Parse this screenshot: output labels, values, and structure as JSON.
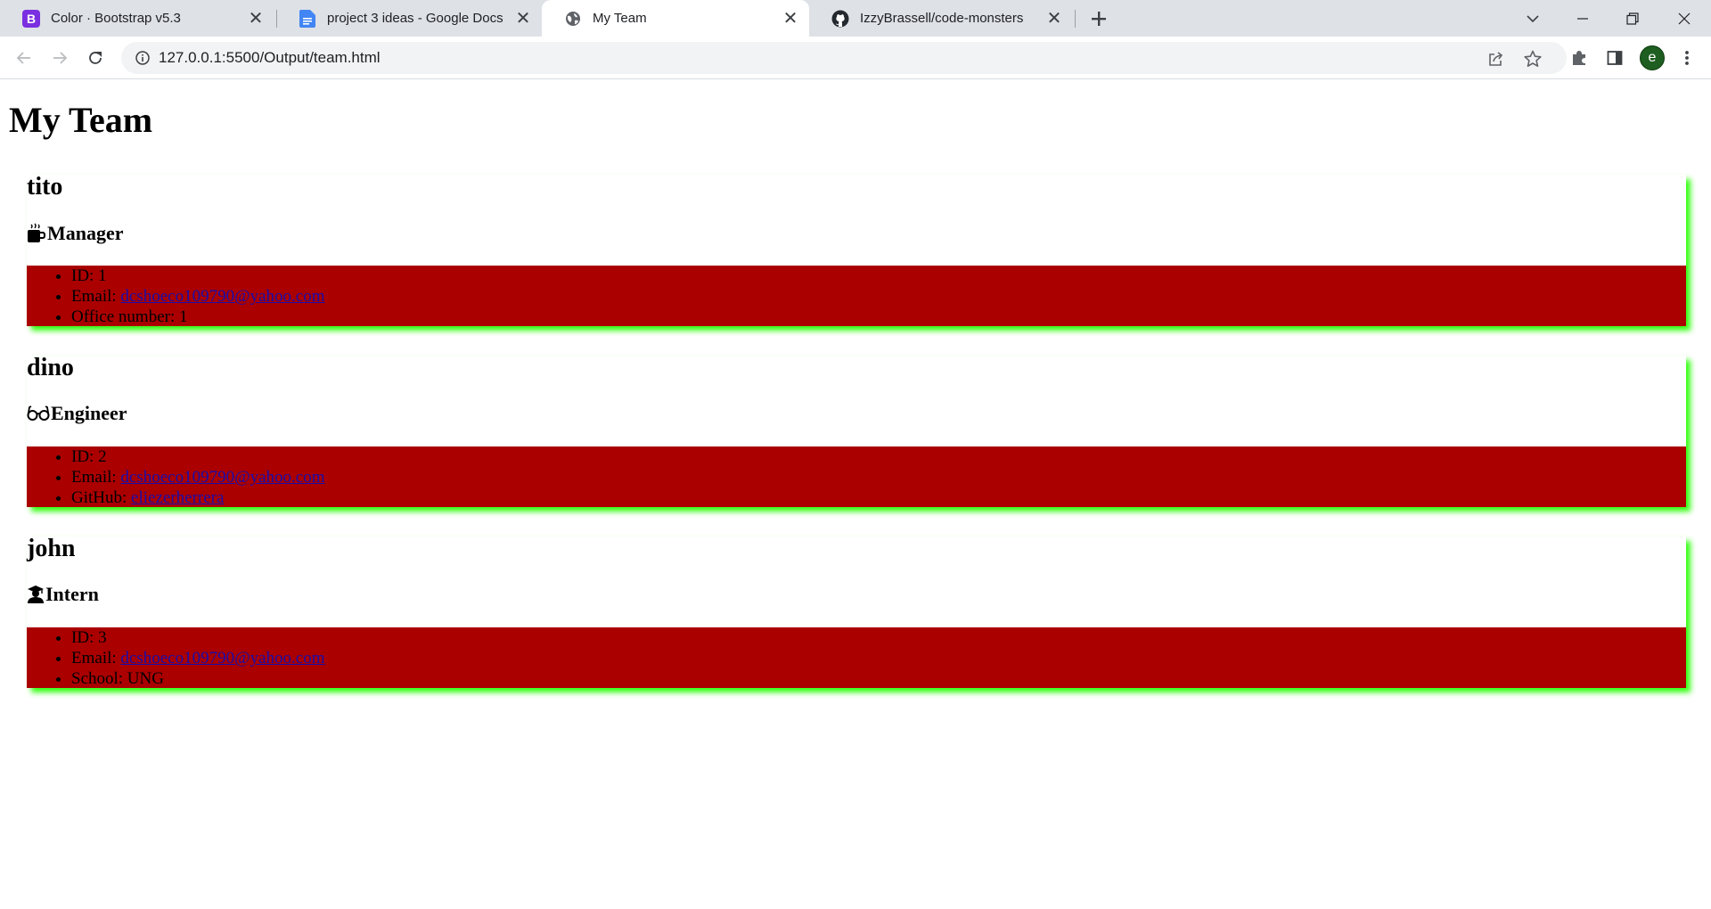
{
  "browser": {
    "tabs": [
      {
        "title": "Color · Bootstrap v5.3",
        "icon": "bootstrap-icon",
        "active": false
      },
      {
        "title": "project 3 ideas - Google Docs",
        "icon": "google-docs-icon",
        "active": false
      },
      {
        "title": "My Team",
        "icon": "globe-icon",
        "active": true
      },
      {
        "title": "IzzyBrassell/code-monsters",
        "icon": "github-icon",
        "active": false
      }
    ],
    "url": "127.0.0.1:5500/Output/team.html",
    "profile_initial": "e"
  },
  "page": {
    "title": "My Team",
    "members": [
      {
        "name": "tito",
        "role": "Manager",
        "role_icon": "coffee-mug-icon",
        "id_label": "ID: 1",
        "email_prefix": "Email: ",
        "email": "dcshoeco109790@yahoo.com",
        "extra_label": "Office number: 1"
      },
      {
        "name": "dino",
        "role": "Engineer",
        "role_icon": "glasses-icon",
        "id_label": "ID: 2",
        "email_prefix": "Email: ",
        "email": "dcshoeco109790@yahoo.com",
        "extra_prefix": "GitHub: ",
        "github": "eliezerherrera"
      },
      {
        "name": "john",
        "role": "Intern",
        "role_icon": "graduate-icon",
        "id_label": "ID: 3",
        "email_prefix": "Email: ",
        "email": "dcshoeco109790@yahoo.com",
        "extra_label": "School: UNG"
      }
    ]
  },
  "colors": {
    "card_list_bg": "#aa0000",
    "card_shadow": "#33ff11",
    "link": "#1a0dab"
  }
}
